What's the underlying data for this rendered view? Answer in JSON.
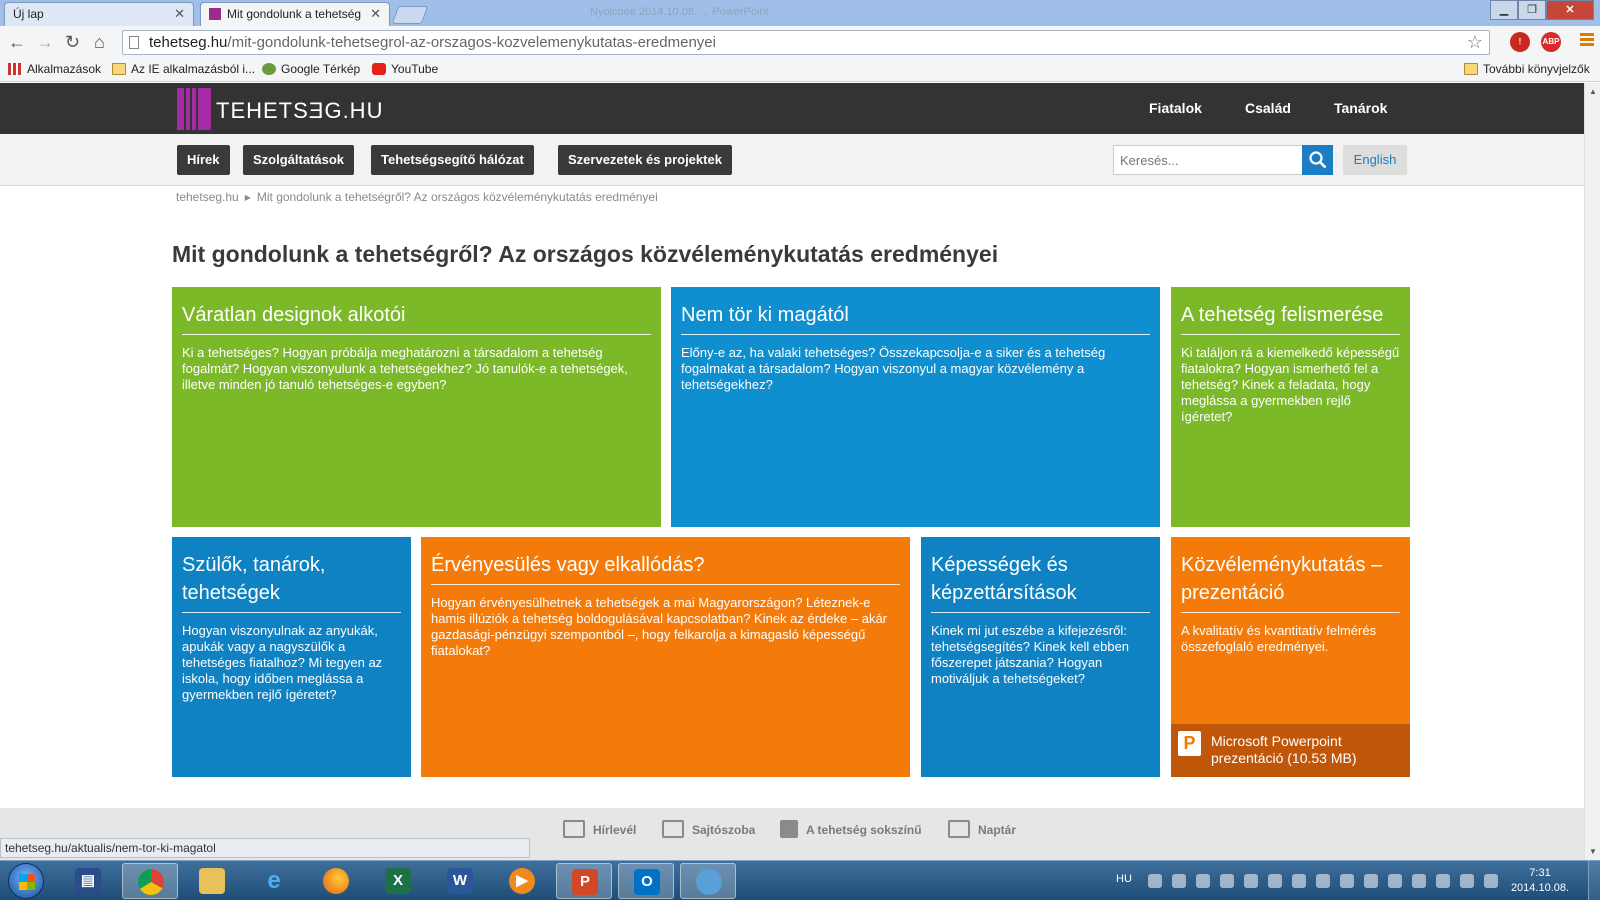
{
  "browser": {
    "window_title": "Nyolcbee 2014.10.08. ... PowerPoint",
    "tabs": [
      {
        "label": "Új lap"
      },
      {
        "label": "Mit gondolunk a tehetség"
      }
    ],
    "url_host": "tehetseg.hu",
    "url_path": "/mit-gondolunk-tehetsegrol-az-orszagos-kozvelemenykutatas-eredmenyei",
    "extensions": [
      "ABP"
    ],
    "bookmarks": [
      {
        "label": "Alkalmazások",
        "icon": "apps-icon"
      },
      {
        "label": "Az IE alkalmazásból i...",
        "icon": "folder-icon"
      },
      {
        "label": "Google Térkép",
        "icon": "maps-icon"
      },
      {
        "label": "YouTube",
        "icon": "youtube-icon"
      }
    ],
    "other_bookmarks": "További könyvjelzők",
    "status_url": "tehetseg.hu/aktualis/nem-tor-ki-magatol"
  },
  "site": {
    "logo_text": "TEHETSƎG.HU",
    "top_nav": [
      "Fiatalok",
      "Család",
      "Tanárok"
    ],
    "sub_nav": [
      "Hírek",
      "Szolgáltatások",
      "Tehetségsegítő hálózat",
      "Szervezetek és projektek"
    ],
    "search_placeholder": "Keresés...",
    "lang_button": "English",
    "breadcrumb": [
      "tehetseg.hu",
      "Mit gondolunk a tehetségről? Az országos közvéleménykutatás eredményei"
    ],
    "page_title": "Mit gondolunk a tehetségről? Az országos közvéleménykutatás eredményei",
    "tiles": [
      {
        "title": "Váratlan designok alkotói",
        "text": "Ki a tehetséges? Hogyan próbálja meghatározni a társadalom a tehetség fogalmát? Hogyan viszonyulunk a tehetségekhez? Jó tanulók-e a tehetségek, illetve minden jó tanuló tehetséges-e egyben?",
        "color": "#7bb928"
      },
      {
        "title": "Nem tör ki magától",
        "text": "Előny-e az, ha valaki tehetséges? Összekapcsolja-e a siker és a tehetség fogalmakat a társadalom? Hogyan viszonyul a magyar közvélemény a tehetségekhez?",
        "color": "#0f8fd0"
      },
      {
        "title": "A tehetség felismerése",
        "text": "Ki találjon rá a kiemelkedő képességű fiatalokra? Hogyan ismerhető fel a tehetség? Kinek a feladata, hogy meglássa a gyermekben rejlő ígéretet?",
        "color": "#7bb928"
      },
      {
        "title": "Szülők, tanárok, tehetségek",
        "text": "Hogyan viszonyulnak az anyukák, apukák vagy a nagyszülők a tehetséges fiatalhoz? Mi tegyen az iskola, hogy időben meglássa a gyermekben rejlő ígéretet?",
        "color": "#0f82c4"
      },
      {
        "title": "Érvényesülés vagy elkallódás?",
        "text": "Hogyan érvényesülhetnek a tehetségek a mai Magyarországon? Léteznek-e hamis illúziók a tehetség boldogulásával kapcsolatban? Kinek az érdeke – akár gazdasági-pénzügyi szempontból –, hogy felkarolja a kimagasló képességű fiatalokat?",
        "color": "#f47b09"
      },
      {
        "title": "Képességek és képzettársítások",
        "text": "Kinek mi jut eszébe a kifejezésről: tehetségsegítés? Kinek kell ebben főszerepet játszania? Hogyan motiváljuk a tehetségeket?",
        "color": "#0f82c4"
      },
      {
        "title": "Közvéleménykutatás – prezentáció",
        "text": "A kvalitatív és kvantitatív felmérés összefoglaló eredményei.",
        "color": "#f47b09",
        "attachment": "Microsoft Powerpoint prezentáció (10.53 MB)"
      }
    ],
    "footer_links": [
      {
        "label": "Hírlevél",
        "icon": "mail-icon"
      },
      {
        "label": "Sajtószoba",
        "icon": "newspaper-icon"
      },
      {
        "label": "A tehetség sokszínű",
        "icon": "facebook-icon"
      },
      {
        "label": "Naptár",
        "icon": "calendar-icon"
      }
    ]
  },
  "taskbar": {
    "apps": [
      "save-app",
      "chrome",
      "explorer",
      "internet-explorer",
      "firefox",
      "excel",
      "word",
      "media-player",
      "powerpoint",
      "outlook",
      "network-app"
    ],
    "lang": "HU",
    "time": "7:31",
    "date": "2014.10.08."
  }
}
